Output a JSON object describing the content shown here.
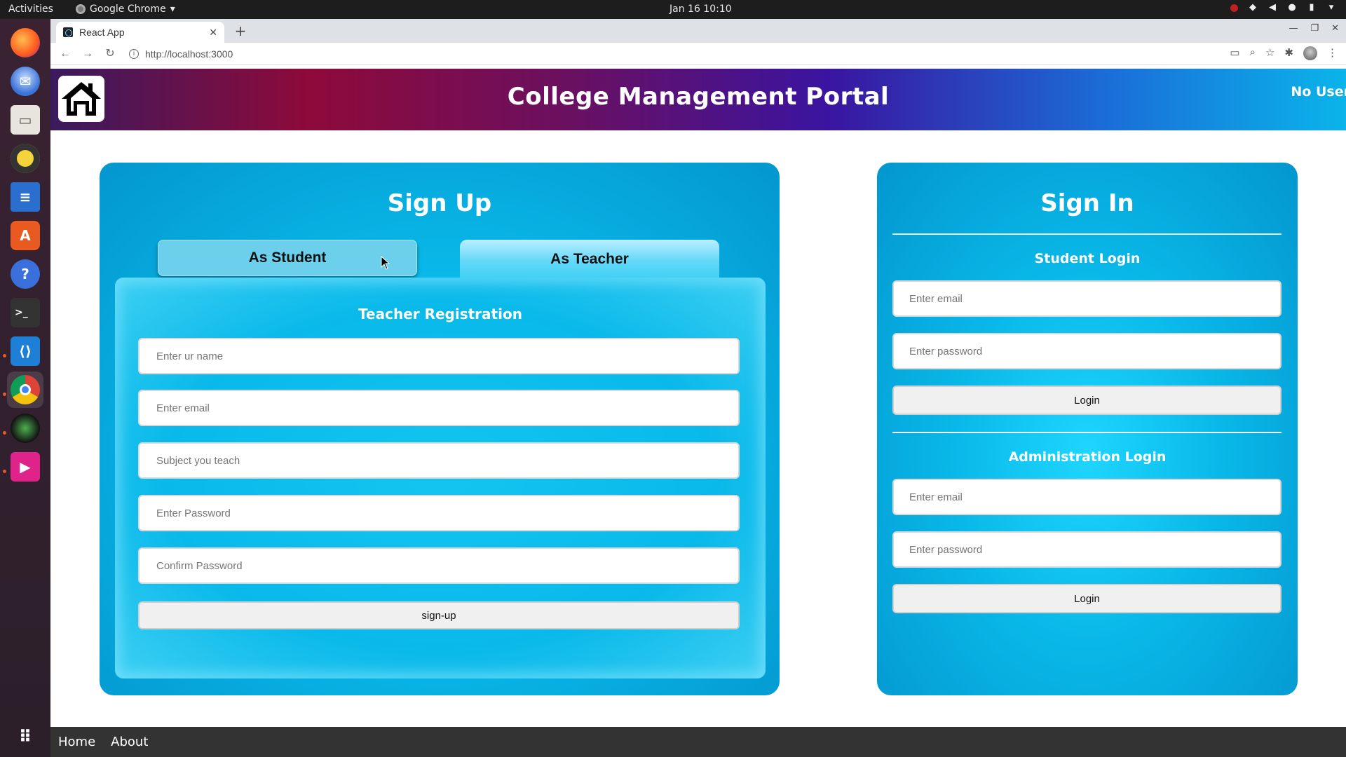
{
  "system": {
    "activities": "Activities",
    "app_name": "Google Chrome",
    "clock": "Jan 16  10:10"
  },
  "browser": {
    "tab_title": "React App",
    "url": "http://localhost:3000"
  },
  "header": {
    "title": "College Management Portal",
    "user_status": "No User"
  },
  "signup": {
    "title": "Sign Up",
    "tabs": [
      {
        "label": "As Student"
      },
      {
        "label": "As Teacher"
      }
    ],
    "form_title": "Teacher Registration",
    "fields": [
      {
        "placeholder": "Enter ur name"
      },
      {
        "placeholder": "Enter email"
      },
      {
        "placeholder": "Subject you teach"
      },
      {
        "placeholder": "Enter Password"
      },
      {
        "placeholder": "Confirm Password"
      }
    ],
    "submit_label": "sign-up"
  },
  "signin": {
    "title": "Sign In",
    "student": {
      "title": "Student Login",
      "email_placeholder": "Enter email",
      "password_placeholder": "Enter password",
      "button_label": "Login"
    },
    "admin": {
      "title": "Administration Login",
      "email_placeholder": "Enter email",
      "password_placeholder": "Enter password",
      "button_label": "Login"
    }
  },
  "footer": {
    "links": [
      {
        "label": "Home"
      },
      {
        "label": "About"
      }
    ]
  },
  "dock": {
    "icons": [
      "firefox-icon",
      "thunderbird-icon",
      "files-icon",
      "rhythmbox-icon",
      "writer-icon",
      "software-icon",
      "help-icon",
      "terminal-icon",
      "vscode-icon",
      "chrome-icon",
      "camera-icon",
      "media-player-icon",
      "app-grid-icon"
    ]
  },
  "colors": {
    "header_gradient": [
      "#3a1a5e",
      "#8e0a3a",
      "#3a14a0",
      "#0ab4ea"
    ],
    "panel": "#09b8e8",
    "footer": "#333333"
  }
}
